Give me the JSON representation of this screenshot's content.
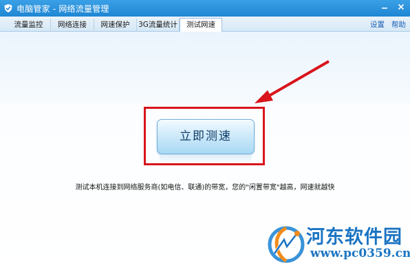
{
  "window": {
    "title": "电脑管家 - 网络流量管理",
    "minimize_icon": "minimize-icon",
    "close_icon": "close-icon"
  },
  "tabs": [
    {
      "label": "流量监控",
      "active": false
    },
    {
      "label": "网络连接",
      "active": false
    },
    {
      "label": "网速保护",
      "active": false
    },
    {
      "label": "3G流量统计",
      "active": false
    },
    {
      "label": "测试网速",
      "active": true
    }
  ],
  "links": {
    "settings": "设置",
    "help": "帮助"
  },
  "main": {
    "start_button": "立即测速",
    "description": "测试本机连接到网络服务商(如电信、联通)的带宽，您的\"闲置带宽\"越高，网速就越快"
  },
  "annotation": {
    "highlight_color": "#d9141b",
    "arrow_color": "#d9141b"
  },
  "watermark": {
    "title": "河东软件园",
    "url": "www.pc0359.cn",
    "color": "#1b74c2"
  }
}
